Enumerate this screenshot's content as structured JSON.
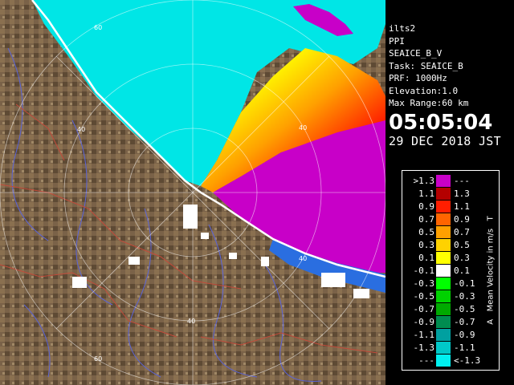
{
  "radar_view": {
    "ring_labels": [
      "40",
      "40",
      "40",
      "40",
      "60",
      "60"
    ],
    "colors": {
      "land": "#7a6248",
      "land_dark": "#4e3c2a",
      "sea": "#00e6e6",
      "approaching": "#c800c8",
      "river": "#5a64d8",
      "border": "#c24a3a",
      "coast": "#ffffff"
    }
  },
  "info": {
    "station": "ilts2",
    "mode": "PPI",
    "product": "SEAICE_B_V",
    "task": "Task: SEAICE_B",
    "prf": "PRF: 1000Hz",
    "elevation": "Elevation:1.0",
    "max_range": "Max Range:60 km",
    "time": "05:05:04",
    "date": "29 DEC 2018 JST"
  },
  "legend": {
    "title": "Mean Velocity in m/s",
    "top_marker": "A",
    "bottom_marker": "T",
    "rows": [
      {
        "left": ">1.3",
        "right": "---",
        "color": "#c800c8"
      },
      {
        "left": "1.1",
        "right": "1.3",
        "color": "#b40000"
      },
      {
        "left": "0.9",
        "right": "1.1",
        "color": "#ff1e00"
      },
      {
        "left": "0.7",
        "right": "0.9",
        "color": "#ff6400"
      },
      {
        "left": "0.5",
        "right": "0.7",
        "color": "#ffa000"
      },
      {
        "left": "0.3",
        "right": "0.5",
        "color": "#ffd200"
      },
      {
        "left": "0.1",
        "right": "0.3",
        "color": "#ffff00"
      },
      {
        "left": "-0.1",
        "right": "0.1",
        "color": "#ffffff"
      },
      {
        "left": "-0.3",
        "right": "-0.1",
        "color": "#00ff00"
      },
      {
        "left": "-0.5",
        "right": "-0.3",
        "color": "#00d200"
      },
      {
        "left": "-0.7",
        "right": "-0.5",
        "color": "#00aa00"
      },
      {
        "left": "-0.9",
        "right": "-0.7",
        "color": "#008c50"
      },
      {
        "left": "-1.1",
        "right": "-0.9",
        "color": "#00a0a0"
      },
      {
        "left": "-1.3",
        "right": "-1.1",
        "color": "#00c8c8"
      },
      {
        "left": "---",
        "right": "<-1.3",
        "color": "#00f0f0"
      }
    ]
  }
}
